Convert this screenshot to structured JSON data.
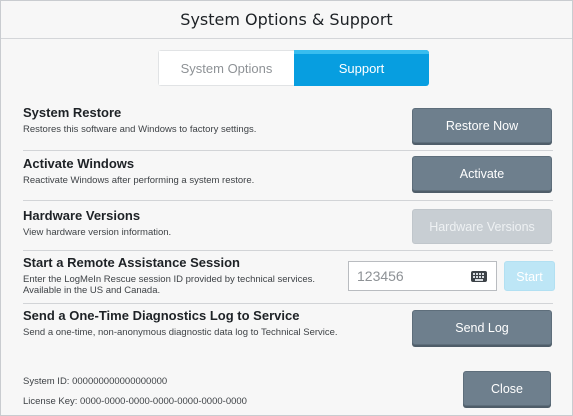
{
  "dialog": {
    "title": "System Options & Support"
  },
  "tabs": [
    {
      "label": "System Options",
      "selected": false
    },
    {
      "label": "Support",
      "selected": true
    }
  ],
  "rows": {
    "restore": {
      "title": "System Restore",
      "description": "Restores this software and Windows to factory settings.",
      "button": "Restore Now"
    },
    "activate": {
      "title": "Activate Windows",
      "description": "Reactivate Windows after performing a system restore.",
      "button": "Activate"
    },
    "hardware": {
      "title": "Hardware Versions",
      "description": "View hardware version information.",
      "button": "Hardware Versions",
      "button_enabled": false
    },
    "remote": {
      "title": "Start a Remote Assistance Session",
      "description": "Enter the LogMeIn Rescue session ID provided by technical services. Available in the US and Canada.",
      "session_id": "123456",
      "button": "Start",
      "button_enabled": false
    },
    "diagnostics": {
      "title": "Send a One-Time Diagnostics Log to Service",
      "description": "Send a one-time, non-anonymous diagnostic data log to Technical Service.",
      "button": "Send Log"
    }
  },
  "footer": {
    "system_id": "System ID: 000000000000000000",
    "license_key": "License Key: 0000-0000-0000-0000-0000-0000-0000",
    "close": "Close"
  },
  "colors": {
    "accent": "#079ee0",
    "button": "#6e7f8d",
    "button_disabled": "#c8ced3",
    "start_disabled": "#bde6f6"
  },
  "icons": {
    "session_input": "keyboard-icon"
  }
}
